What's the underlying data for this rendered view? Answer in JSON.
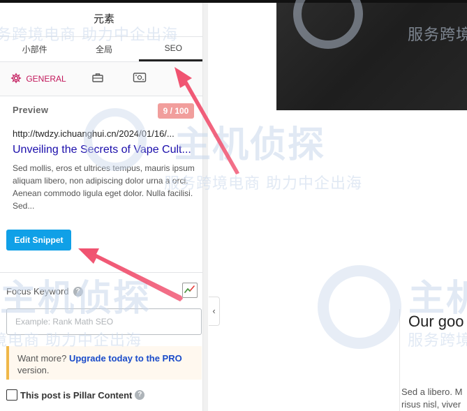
{
  "panel": {
    "title": "元素",
    "tabs": [
      {
        "label": "小部件",
        "active": false
      },
      {
        "label": "全局",
        "active": false
      },
      {
        "label": "SEO",
        "active": true
      }
    ],
    "subtabs": {
      "general_label": "GENERAL",
      "general_icon": "gear-icon",
      "icon2": "toolbox-icon",
      "icon3": "social-card-icon"
    },
    "preview": {
      "heading": "Preview",
      "score": "9 / 100",
      "url": "http://twdzy.ichuanghui.cn/2024/01/16/...",
      "title": "Unveiling the Secrets of Vape Cult...",
      "description": "Sed mollis, eros et ultrices tempus, mauris ipsum aliquam libero, non adipiscing dolor urna a orci. Aenean commodo ligula eget dolor. Nulla facilisi. Sed..."
    },
    "edit_snippet_label": "Edit Snippet",
    "focus_keyword": {
      "label": "Focus Keyword",
      "help": "?",
      "placeholder": "Example: Rank Math SEO",
      "value": ""
    },
    "upsell": {
      "prefix": "Want more? ",
      "link": "Upgrade today to the PRO",
      "suffix": " version."
    },
    "pillar": {
      "label": "This post is Pillar Content",
      "checked": false
    }
  },
  "canvas": {
    "collapse_glyph": "‹",
    "card_title": "Our goo",
    "card_text_line1": "Sed a libero. M",
    "card_text_line2": "risus nisl, viver"
  },
  "watermark": {
    "brand": "主机侦探",
    "tagline": "服务跨境电商 助力中企出海",
    "tagline_short": "服务跨境",
    "tagline_left": "务跨境电商 助力中企出海",
    "tagline_right": "服务跨境电商 助力中企出海",
    "tagline_bottom": "境电商 助力中企出海"
  },
  "colors": {
    "accent": "#c2185b",
    "button": "#10a0e7",
    "score_bg": "#f19e9c",
    "link": "#1a0dab",
    "arrow": "#f0506e"
  }
}
